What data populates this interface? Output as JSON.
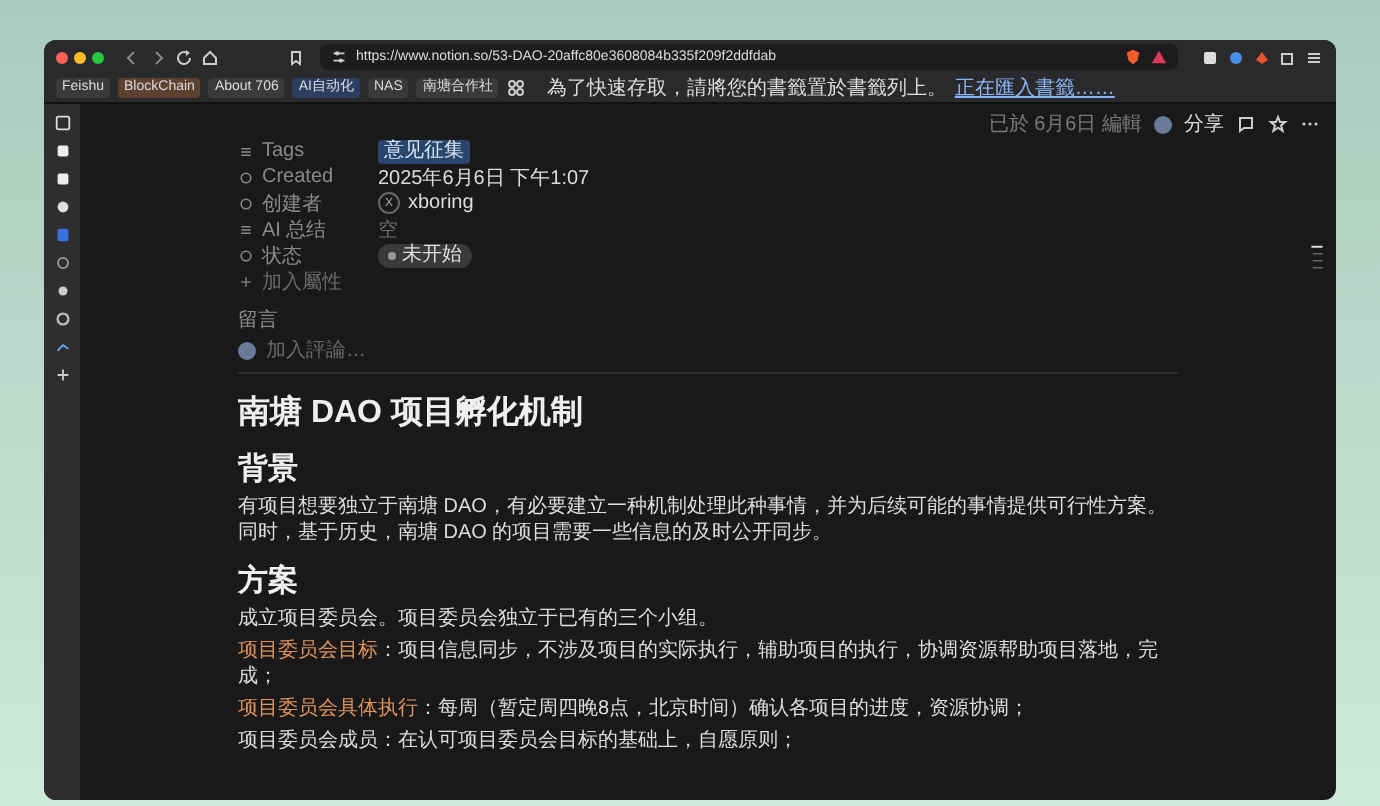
{
  "browser": {
    "url": "https://www.notion.so/53-DAO-20affc80e3608084b335f209f2ddfdab",
    "bookmarks": [
      {
        "label": "Feishu",
        "color": "#3a3a3c"
      },
      {
        "label": "BlockChain",
        "color": "#5c4030"
      },
      {
        "label": "About 706",
        "color": "#3a3a3c"
      },
      {
        "label": "AI自动化",
        "color": "#2c3f63"
      },
      {
        "label": "NAS",
        "color": "#3a3a3c"
      },
      {
        "label": "南塘合作社",
        "color": "#3a3a3c"
      }
    ],
    "bookmark_hint": "為了快速存取，請將您的書籤置於書籤列上。",
    "bookmark_link": "正在匯入書籤……"
  },
  "page_header": {
    "edited": "已於 6月6日 編輯",
    "share": "分享"
  },
  "properties": [
    {
      "kind": "tag",
      "label": "Tags",
      "value": "意见征集"
    },
    {
      "kind": "text",
      "label": "Created",
      "value": "2025年6月6日 下午1:07"
    },
    {
      "kind": "person",
      "label": "创建者",
      "value": "xboring",
      "avatar": "X"
    },
    {
      "kind": "empty",
      "label": "AI 总结",
      "value": "空"
    },
    {
      "kind": "status",
      "label": "状态",
      "value": "未开始"
    }
  ],
  "add_property": "加入屬性",
  "comments": {
    "label": "留言",
    "placeholder": "加入評論…"
  },
  "title": "南塘 DAO 项目孵化机制",
  "sections": [
    {
      "heading": "背景",
      "paragraphs": [
        "有项目想要独立于南塘 DAO，有必要建立一种机制处理此种事情，并为后续可能的事情提供可行性方案。同时，基于历史，南塘 DAO 的项目需要一些信息的及时公开同步。"
      ]
    },
    {
      "heading": "方案",
      "paragraphs": [
        "成立项目委员会。项目委员会独立于已有的三个小组。",
        "**项目委员会目标**：项目信息同步，不涉及项目的实际执行，辅助项目的执行，协调资源帮助项目落地，完成；",
        "**项目委员会具体执行**：每周（暂定周四晚8点，北京时间）确认各项目的进度，资源协调；",
        "项目委员会成员：在认可项目委员会目标的基础上，自愿原则；"
      ]
    }
  ]
}
